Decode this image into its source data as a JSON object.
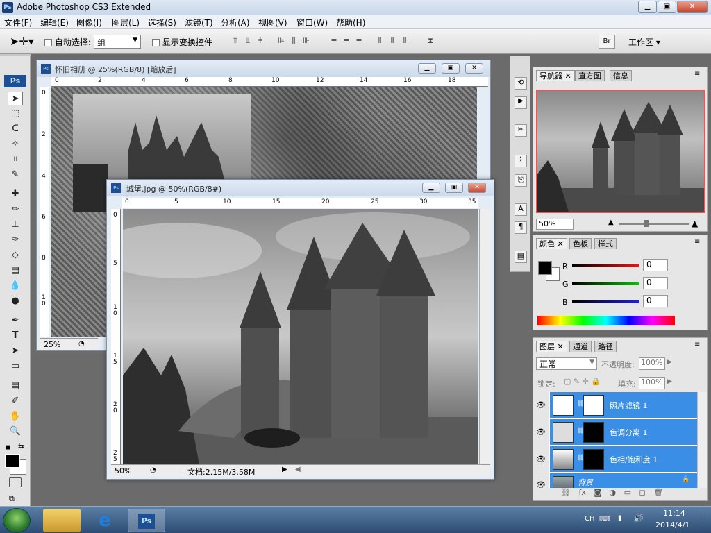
{
  "app": {
    "title": "Adobe Photoshop CS3 Extended",
    "logo": "Ps"
  },
  "menu": [
    "文件(F)",
    "编辑(E)",
    "图像(I)",
    "图层(L)",
    "选择(S)",
    "滤镜(T)",
    "分析(A)",
    "视图(V)",
    "窗口(W)",
    "帮助(H)"
  ],
  "options": {
    "auto_select_label": "自动选择:",
    "auto_select_value": "组",
    "show_transform_label": "显示变换控件",
    "workspace_label": "工作区 ▾"
  },
  "doc1": {
    "title": "怀旧相册 @ 25%(RGB/8) [缩放后]",
    "zoom": "25%",
    "ruler_h": [
      "0",
      "2",
      "4",
      "6",
      "8",
      "10",
      "12",
      "14",
      "16",
      "18"
    ],
    "ruler_v": [
      "0",
      "2",
      "4",
      "6",
      "8",
      "1\n0"
    ]
  },
  "doc2": {
    "title": "城堡.jpg @ 50%(RGB/8#)",
    "zoom": "50%",
    "docinfo": "文档:2.15M/3.58M",
    "ruler_h": [
      "0",
      "5",
      "10",
      "15",
      "20",
      "25",
      "30",
      "35"
    ],
    "ruler_v": [
      "0",
      "5",
      "1\n0",
      "1\n5",
      "2\n0",
      "2\n5"
    ]
  },
  "navigator": {
    "tabs": [
      "导航器",
      "直方图",
      "信息"
    ],
    "zoom": "50%"
  },
  "color_panel": {
    "tabs": [
      "颜色",
      "色板",
      "样式"
    ],
    "channels": [
      {
        "label": "R",
        "value": "0",
        "color": "#d02020"
      },
      {
        "label": "G",
        "value": "0",
        "color": "#20a020"
      },
      {
        "label": "B",
        "value": "0",
        "color": "#2020c0"
      }
    ]
  },
  "layers_panel": {
    "tabs": [
      "图层",
      "通道",
      "路径"
    ],
    "blend_mode": "正常",
    "opacity_label": "不透明度:",
    "opacity_value": "100%",
    "lock_label": "锁定:",
    "fill_label": "填充:",
    "fill_value": "100%",
    "layers": [
      {
        "name": "照片滤镜 1"
      },
      {
        "name": "色调分离 1"
      },
      {
        "name": "色相/饱和度 1"
      },
      {
        "name": "背景"
      }
    ]
  },
  "taskbar": {
    "lang": "CH",
    "time": "11:14",
    "date": "2014/4/1",
    "active_app": "Ps"
  }
}
